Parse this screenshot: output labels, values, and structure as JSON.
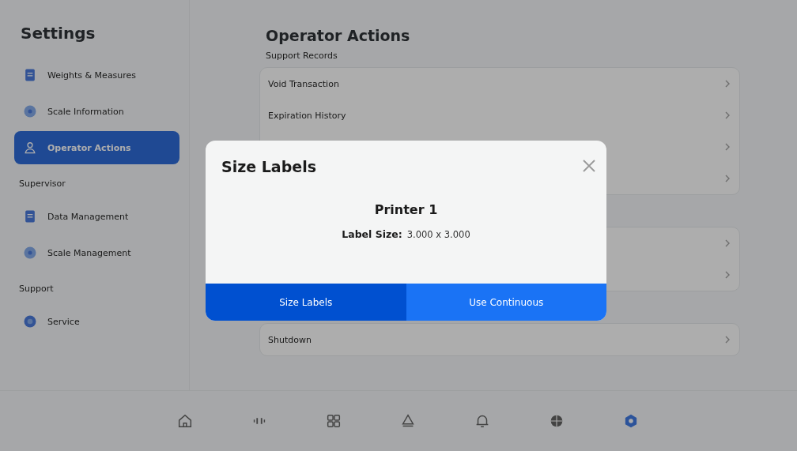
{
  "sidebar": {
    "title": "Settings",
    "sections": [
      {
        "items": [
          {
            "label": "Weights & Measures",
            "selected": false
          },
          {
            "label": "Scale Information",
            "selected": false
          },
          {
            "label": "Operator Actions",
            "selected": true
          }
        ]
      },
      {
        "heading": "Supervisor",
        "items": [
          {
            "label": "Data Management",
            "selected": false
          },
          {
            "label": "Scale Management",
            "selected": false
          }
        ]
      },
      {
        "heading": "Support",
        "items": [
          {
            "label": "Service",
            "selected": false
          }
        ]
      }
    ]
  },
  "main": {
    "title": "Operator Actions",
    "subtitle": "Support Records",
    "cards": [
      {
        "rows": [
          "Void Transaction",
          "Expiration History",
          "",
          ""
        ]
      },
      {
        "rows": [
          "",
          ""
        ]
      },
      {
        "rows": [
          "Shutdown"
        ]
      }
    ]
  },
  "nav": {
    "items": [
      {
        "selected": false
      },
      {
        "selected": false
      },
      {
        "selected": false
      },
      {
        "selected": false
      },
      {
        "selected": false
      },
      {
        "selected": false
      },
      {
        "selected": true
      }
    ]
  },
  "dialog": {
    "title": "Size Labels",
    "printer": "Printer 1",
    "label_caption": "Label Size:",
    "label_value": "3.000 x 3.000",
    "buttons": [
      {
        "label": "Size Labels",
        "kind": "pressed"
      },
      {
        "label": "Use Continuous",
        "kind": "normal"
      }
    ]
  }
}
